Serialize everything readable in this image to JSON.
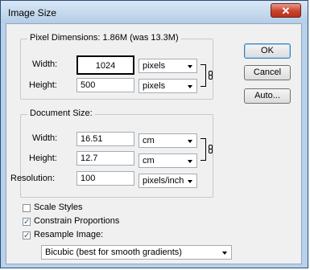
{
  "window": {
    "title": "Image Size",
    "close_glyph": "✕"
  },
  "pixel_dimensions": {
    "legend": "Pixel Dimensions:  1.86M (was 13.3M)",
    "width_label": "Width:",
    "width_value": "1024",
    "width_unit": "pixels",
    "height_label": "Height:",
    "height_value": "500",
    "height_unit": "pixels"
  },
  "document_size": {
    "legend": "Document Size:",
    "width_label": "Width:",
    "width_value": "16.51",
    "width_unit": "cm",
    "height_label": "Height:",
    "height_value": "12.7",
    "height_unit": "cm",
    "resolution_label": "Resolution:",
    "resolution_value": "100",
    "resolution_unit": "pixels/inch"
  },
  "options": {
    "scale_styles": {
      "label": "Scale Styles",
      "checked": false
    },
    "constrain_proportions": {
      "label": "Constrain Proportions",
      "checked": true
    },
    "resample_image": {
      "label": "Resample Image:",
      "checked": true
    },
    "resample_method": "Bicubic (best for smooth gradients)"
  },
  "buttons": {
    "ok": "OK",
    "cancel": "Cancel",
    "auto": "Auto..."
  },
  "colors": {
    "titlebar": "#c8dcf0",
    "close": "#c7432c",
    "check": "#2a5a96"
  }
}
